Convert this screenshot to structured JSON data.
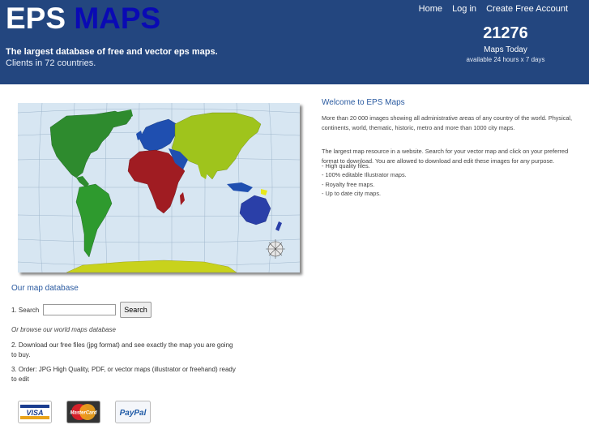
{
  "header": {
    "logo_part1": "EPS",
    "logo_part2": "MAPS",
    "tagline": "The largest database of free and vector eps maps.",
    "clients": "Clients in 72 countries.",
    "nav": [
      "Home",
      "Log in",
      "Create Free Account"
    ],
    "counter": "21276",
    "counter_label": "Maps Today",
    "counter_sub": "available 24 hours x 7 days"
  },
  "left": {
    "section_title": "Our map database",
    "search_label": "1. Search",
    "search_value": "",
    "search_button": "Search",
    "browse_text": "Or browse our world maps database",
    "step2": "2. Download our free files (jpg format) and see exactly the map you are going to buy.",
    "step3": "3. Order: JPG High Quality, PDF, or vector maps (illustrator or freehand) ready to edit",
    "payment": [
      "VISA",
      "MasterCard",
      "PayPal"
    ]
  },
  "right": {
    "title": "Welcome to EPS Maps",
    "p1": "More than 20 000 images showing all administrative areas of any country of the world. Physical, continents, world, thematic, historic, metro and more than 1000 city maps.",
    "p2": "The largest map resource in a website. Search for your vector map and click on your preferred format to download. You are allowed to download and edit these images for any purpose.",
    "features": [
      "- High quality files.",
      "- 100% editable Illustrator maps.",
      "- Royalty free maps.",
      "- Up to date city maps."
    ]
  },
  "colors": {
    "header_bg": "#23467f",
    "logo_accent": "#0a0ab4",
    "link_blue": "#2a5aa0",
    "ocean": "#d7e6f2",
    "north_america": "#2e8b2e",
    "south_america": "#2e9a2e",
    "europe": "#1f4fb0",
    "africa": "#a01c22",
    "asia": "#9fc41c",
    "australia": "#2a3fa8",
    "antarctica": "#c8d21c"
  }
}
